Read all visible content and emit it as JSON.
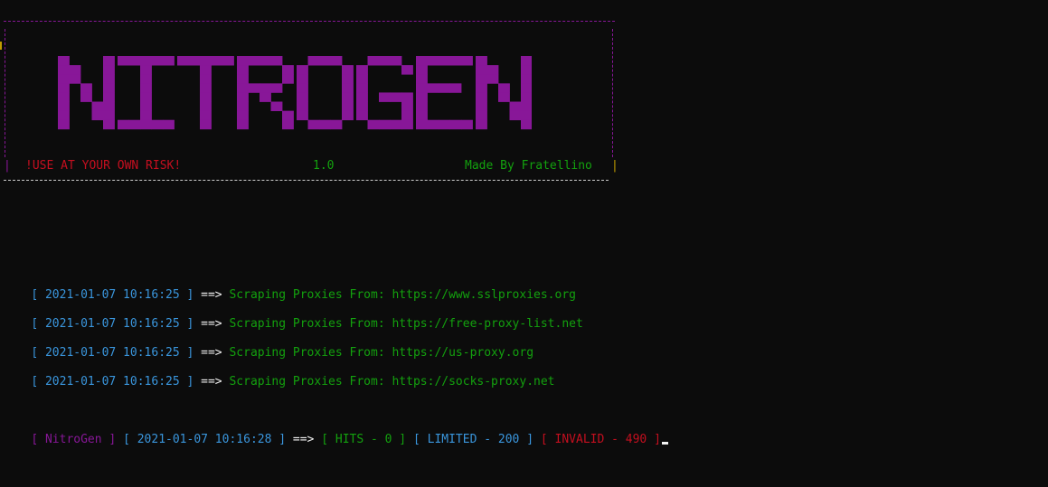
{
  "banner": {
    "logo_text": "NITROGEN",
    "risk_text": "!USE AT YOUR OWN RISK!",
    "version": "1.0",
    "author": "Made By Fratellino",
    "bar": "|"
  },
  "colors": {
    "background": "#0c0c0c",
    "blue": "#3a96dd",
    "white": "#f2f2f2",
    "green": "#16c60c",
    "purple": "#881798",
    "red": "#c50f1f"
  },
  "log": [
    {
      "timestamp": "[ 2021-01-07 10:16:25 ]",
      "arrow": " ==> ",
      "message": "Scraping Proxies From: https://www.sslproxies.org"
    },
    {
      "timestamp": "[ 2021-01-07 10:16:25 ]",
      "arrow": " ==> ",
      "message": "Scraping Proxies From: https://free-proxy-list.net"
    },
    {
      "timestamp": "[ 2021-01-07 10:16:25 ]",
      "arrow": " ==> ",
      "message": "Scraping Proxies From: https://us-proxy.org"
    },
    {
      "timestamp": "[ 2021-01-07 10:16:25 ]",
      "arrow": " ==> ",
      "message": "Scraping Proxies From: https://socks-proxy.net"
    }
  ],
  "status": {
    "app_tag": "[ NitroGen ]",
    "timestamp": "[ 2021-01-07 10:16:28 ]",
    "arrow": " ==> ",
    "hits": "[ HITS - 0 ]",
    "limited": "[ LIMITED - 200 ]",
    "invalid": "[ INVALID - 490 ]"
  }
}
